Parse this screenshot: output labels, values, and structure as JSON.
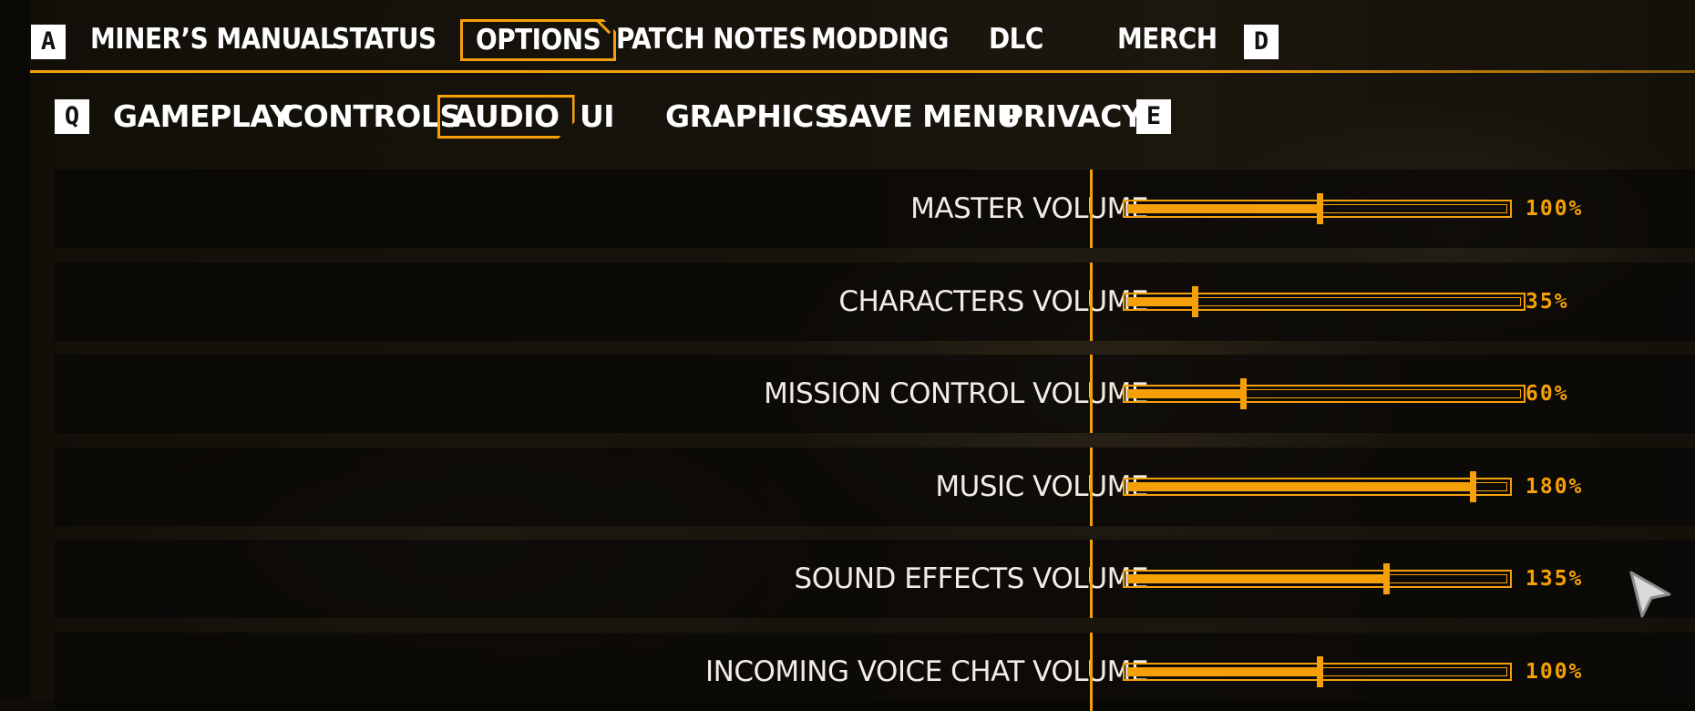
{
  "topnav": {
    "left_key": "A",
    "right_key": "D",
    "tabs": [
      {
        "label": "MINER’S MANUAL"
      },
      {
        "label": "STATUS"
      },
      {
        "label": "OPTIONS"
      },
      {
        "label": "PATCH NOTES"
      },
      {
        "label": "MODDING"
      },
      {
        "label": "DLC"
      },
      {
        "label": "MERCH"
      }
    ],
    "active": "OPTIONS"
  },
  "subnav": {
    "left_key": "Q",
    "right_key": "E",
    "tabs": [
      {
        "label": "GAMEPLAY"
      },
      {
        "label": "CONTROLS"
      },
      {
        "label": "AUDIO"
      },
      {
        "label": "UI"
      },
      {
        "label": "GRAPHICS"
      },
      {
        "label": "SAVE MENU"
      },
      {
        "label": "PRIVACY"
      }
    ],
    "active": "AUDIO"
  },
  "settings": [
    {
      "label": "MASTER VOLUME",
      "value": "100%",
      "level": 0.5,
      "max_percent": 200
    },
    {
      "label": "CHARACTERS VOLUME",
      "value": "35%",
      "level": 0.175,
      "max_percent": 200
    },
    {
      "label": "MISSION CONTROL VOLUME",
      "value": "60%",
      "level": 0.3,
      "max_percent": 200
    },
    {
      "label": "MUSIC VOLUME",
      "value": "180%",
      "level": 0.9,
      "max_percent": 200
    },
    {
      "label": "SOUND EFFECTS VOLUME",
      "value": "135%",
      "level": 0.675,
      "max_percent": 200
    },
    {
      "label": "INCOMING VOICE CHAT VOLUME",
      "value": "100%",
      "level": 0.5,
      "max_percent": 200
    }
  ],
  "colors": {
    "accent": "#f6a008",
    "text": "#ffffff",
    "row_bg": "#080705"
  },
  "icons": {
    "cursor": "mouse-pointer-icon"
  }
}
